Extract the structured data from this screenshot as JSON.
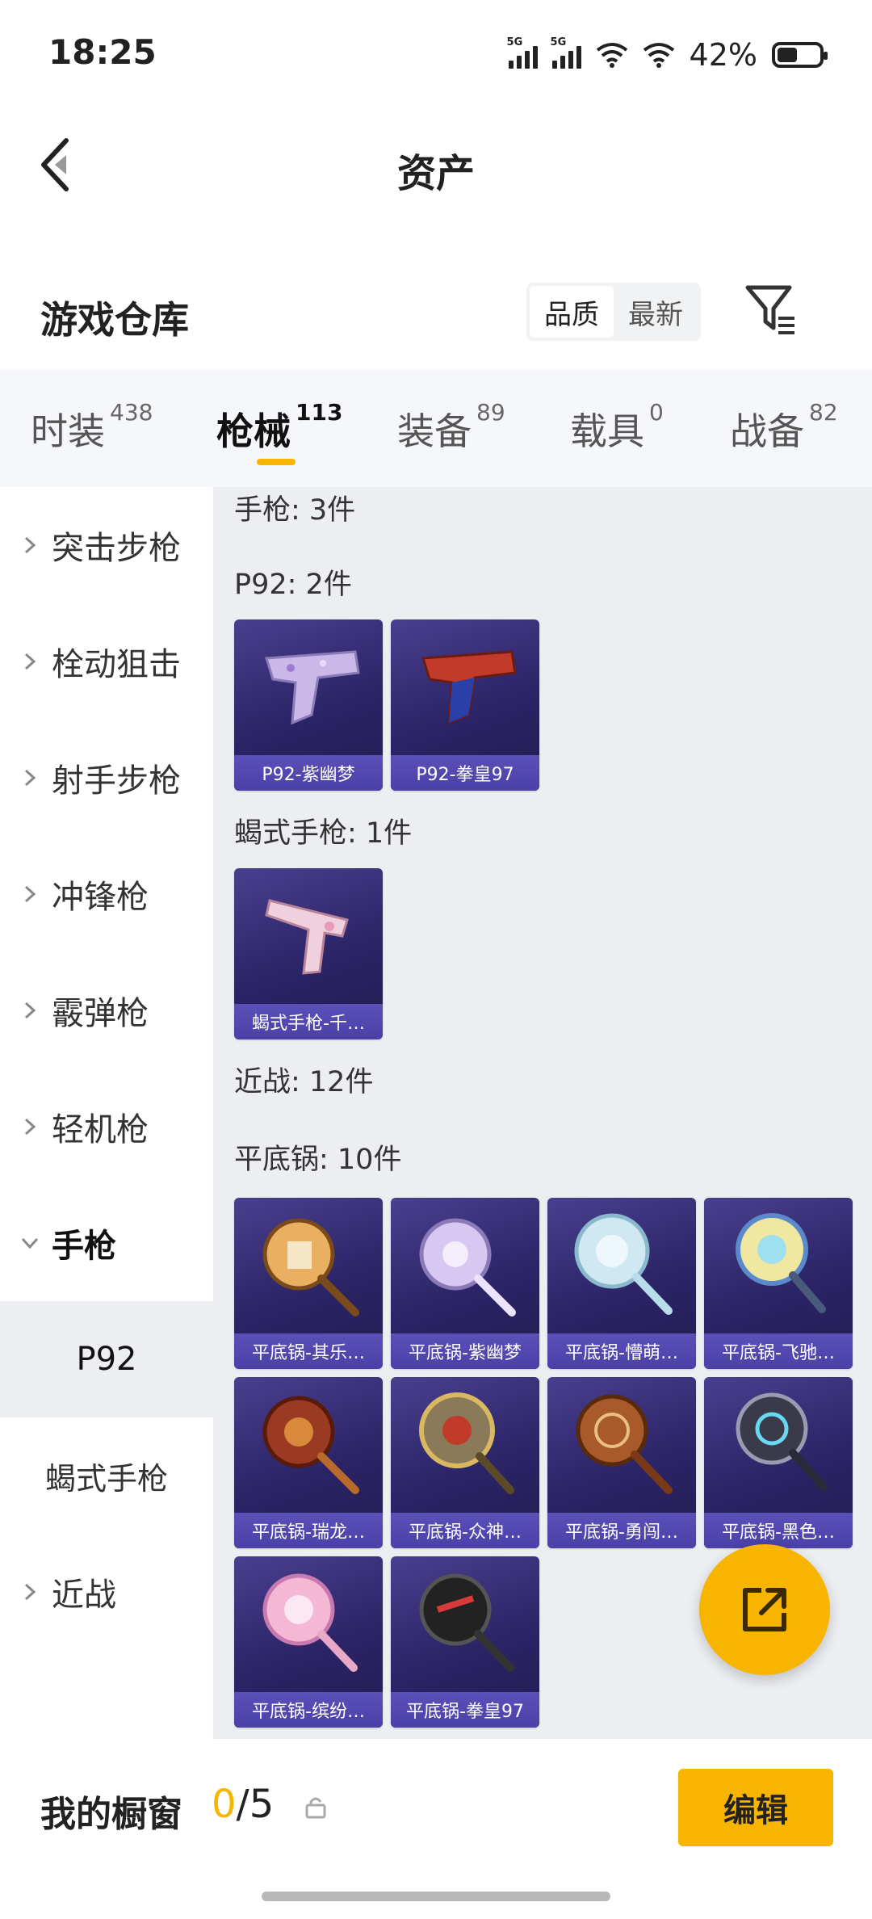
{
  "status": {
    "time": "18:25",
    "network1": "5G",
    "network2": "5G",
    "battery": "42%"
  },
  "header": {
    "title": "资产"
  },
  "section": {
    "title": "游戏仓库",
    "sort_options": [
      "品质",
      "最新"
    ]
  },
  "tabs": [
    {
      "label": "时装",
      "count": "438"
    },
    {
      "label": "枪械",
      "count": "113"
    },
    {
      "label": "装备",
      "count": "89"
    },
    {
      "label": "载具",
      "count": "0"
    },
    {
      "label": "战备",
      "count": "82"
    }
  ],
  "nav": {
    "items": [
      "突击步枪",
      "栓动狙击",
      "射手步枪",
      "冲锋枪",
      "霰弹枪",
      "轻机枪",
      "手枪"
    ],
    "sub_items": [
      "P92",
      "蝎式手枪"
    ],
    "last": "近战"
  },
  "content": {
    "g_pistol": "手枪: 3件",
    "g_p92": "P92: 2件",
    "p92_items": [
      "P92-紫幽梦",
      "P92-拳皇97"
    ],
    "g_scorpion": "蝎式手枪: 1件",
    "scorpion_items": [
      "蝎式手枪-千…"
    ],
    "g_melee": "近战: 12件",
    "g_pan": "平底锅: 10件",
    "pan_items": [
      "平底锅-其乐…",
      "平底锅-紫幽梦",
      "平底锅-懵萌…",
      "平底锅-飞驰…",
      "平底锅-瑞龙…",
      "平底锅-众神…",
      "平底锅-勇闯…",
      "平底锅-黑色…",
      "平底锅-缤纷…",
      "平底锅-拳皇97"
    ]
  },
  "bottom": {
    "label": "我的橱窗",
    "count_used": "0",
    "count_total": "/5",
    "edit": "编辑"
  },
  "colors": {
    "accent": "#f7b500",
    "card_bg": "#2b2466",
    "card_label": "#4a40a8"
  }
}
